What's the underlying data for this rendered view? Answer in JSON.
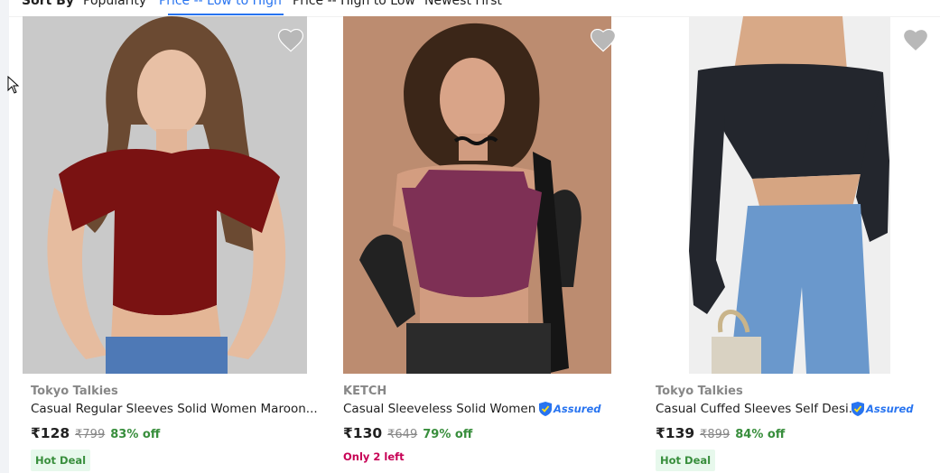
{
  "sort": {
    "label": "Sort By",
    "options": [
      "Popularity",
      "Price -- Low to High",
      "Price -- High to Low",
      "Newest First"
    ],
    "active": "Price -- Low to High"
  },
  "colors": {
    "accent": "#2874f0",
    "discount": "#388e3c",
    "stock_warning": "#c70055"
  },
  "products": [
    {
      "brand": "Tokyo Talkies",
      "title": "Casual Regular Sleeves Solid Women Maroon...",
      "price": "₹128",
      "mrp": "₹799",
      "discount": "83% off",
      "badge": "Hot Deal",
      "assured": false,
      "image_icon": "maroon-crop-top-photo"
    },
    {
      "brand": "KETCH",
      "title": "Casual Sleeveless Solid Women ...",
      "price": "₹130",
      "mrp": "₹649",
      "discount": "79% off",
      "stock_note": "Only 2 left",
      "assured": true,
      "assured_label": "Assured",
      "image_icon": "purple-camisole-top-photo"
    },
    {
      "brand": "Tokyo Talkies",
      "title": "Casual Cuffed Sleeves Self Desi...",
      "price": "₹139",
      "mrp": "₹899",
      "discount": "84% off",
      "badge": "Hot Deal",
      "assured": true,
      "assured_label": "Assured",
      "image_icon": "black-off-shoulder-top-photo"
    }
  ]
}
